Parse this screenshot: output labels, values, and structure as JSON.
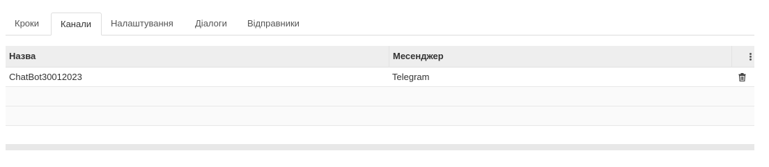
{
  "tabs": [
    {
      "label": "Кроки",
      "active": false
    },
    {
      "label": "Канали",
      "active": true
    },
    {
      "label": "Налаштування",
      "active": false
    },
    {
      "label": "Діалоги",
      "active": false
    },
    {
      "label": "Відправники",
      "active": false
    }
  ],
  "grid": {
    "columns": {
      "name": "Назва",
      "messenger": "Месенджер"
    },
    "rows": [
      {
        "name": "ChatBot30012023",
        "messenger": "Telegram",
        "action_icon": "trash-icon"
      }
    ],
    "menu_icon": "kebab-icon"
  }
}
